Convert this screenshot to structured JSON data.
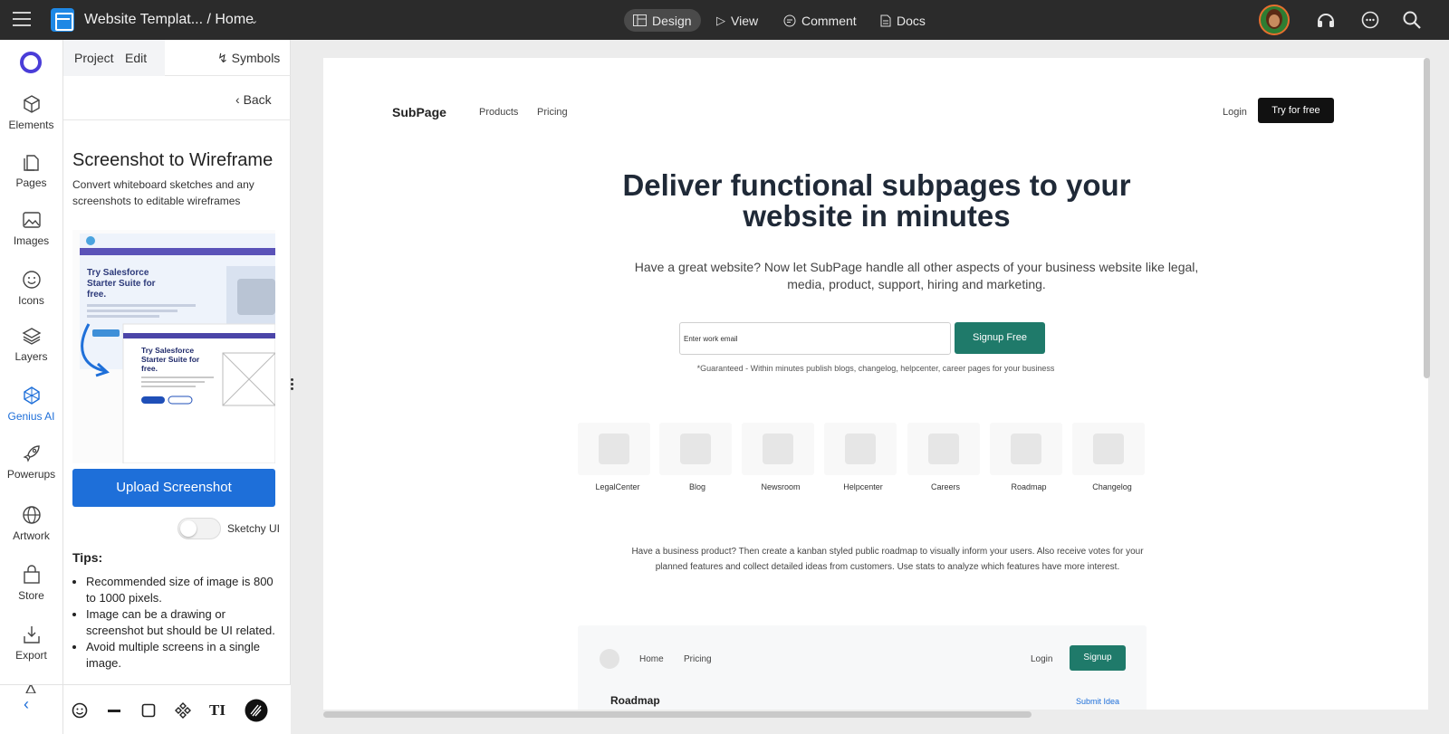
{
  "topbar": {
    "title": "Website Templat... / Home",
    "modes": [
      {
        "label": "Design",
        "icon": "layout-icon"
      },
      {
        "label": "View",
        "icon": "play-icon"
      },
      {
        "label": "Comment",
        "icon": "comment-icon"
      },
      {
        "label": "Docs",
        "icon": "doc-icon"
      }
    ]
  },
  "rail": {
    "items": [
      {
        "label": "Elements",
        "icon": "cube-icon"
      },
      {
        "label": "Pages",
        "icon": "pages-icon"
      },
      {
        "label": "Images",
        "icon": "image-icon"
      },
      {
        "label": "Icons",
        "icon": "smiley-icon"
      },
      {
        "label": "Layers",
        "icon": "layers-icon"
      },
      {
        "label": "Genius AI",
        "icon": "genius-icon"
      },
      {
        "label": "Powerups",
        "icon": "rocket-icon"
      },
      {
        "label": "Artwork",
        "icon": "globe-icon"
      },
      {
        "label": "Store",
        "icon": "bag-icon"
      },
      {
        "label": "Export",
        "icon": "export-icon"
      }
    ],
    "accent": "#1e6fd9"
  },
  "panel": {
    "tabs": [
      "Project",
      "Edit"
    ],
    "symbols": "Symbols",
    "back": "Back",
    "heading": "Screenshot to Wireframe",
    "subtitle": "Convert whiteboard sketches and any screenshots to editable wireframes",
    "illustration": {
      "headline": "Try Salesforce Starter Suite for free.",
      "wire_headline": "Try Salesforce Starter Suite for free."
    },
    "upload_button": "Upload Screenshot",
    "toggle_label": "Sketchy UI",
    "tips_heading": "Tips:",
    "tips": [
      "Recommended size of image is 800 to 1000 pixels.",
      "Image can be a drawing or screenshot but should be UI related.",
      "Avoid multiple screens in a single image."
    ]
  },
  "page": {
    "brand": "SubPage",
    "nav": [
      "Products",
      "Pricing"
    ],
    "login": "Login",
    "try_button": "Try for free",
    "headline": "Deliver functional subpages to your website in minutes",
    "lead": "Have a great website? Now let SubPage handle all other aspects of your business website like legal, media, product, support, hiring and marketing.",
    "email_placeholder": "Enter work email",
    "signup_button": "Signup Free",
    "note": "*Guaranteed - Within minutes publish blogs, changelog, helpcenter, career pages for your business",
    "cards": [
      "LegalCenter",
      "Blog",
      "Newsroom",
      "Helpcenter",
      "Careers",
      "Roadmap",
      "Changelog"
    ],
    "paragraph": "Have a business product? Then create a kanban styled public roadmap to visually inform your users. Also receive votes for your planned features and collect detailed ideas from customers. Use stats to analyze which features have more interest.",
    "mini": {
      "nav": [
        "Home",
        "Pricing"
      ],
      "login": "Login",
      "signup": "Signup",
      "title": "Roadmap",
      "submit": "Submit Idea"
    },
    "accent": "#1f7a6a"
  }
}
